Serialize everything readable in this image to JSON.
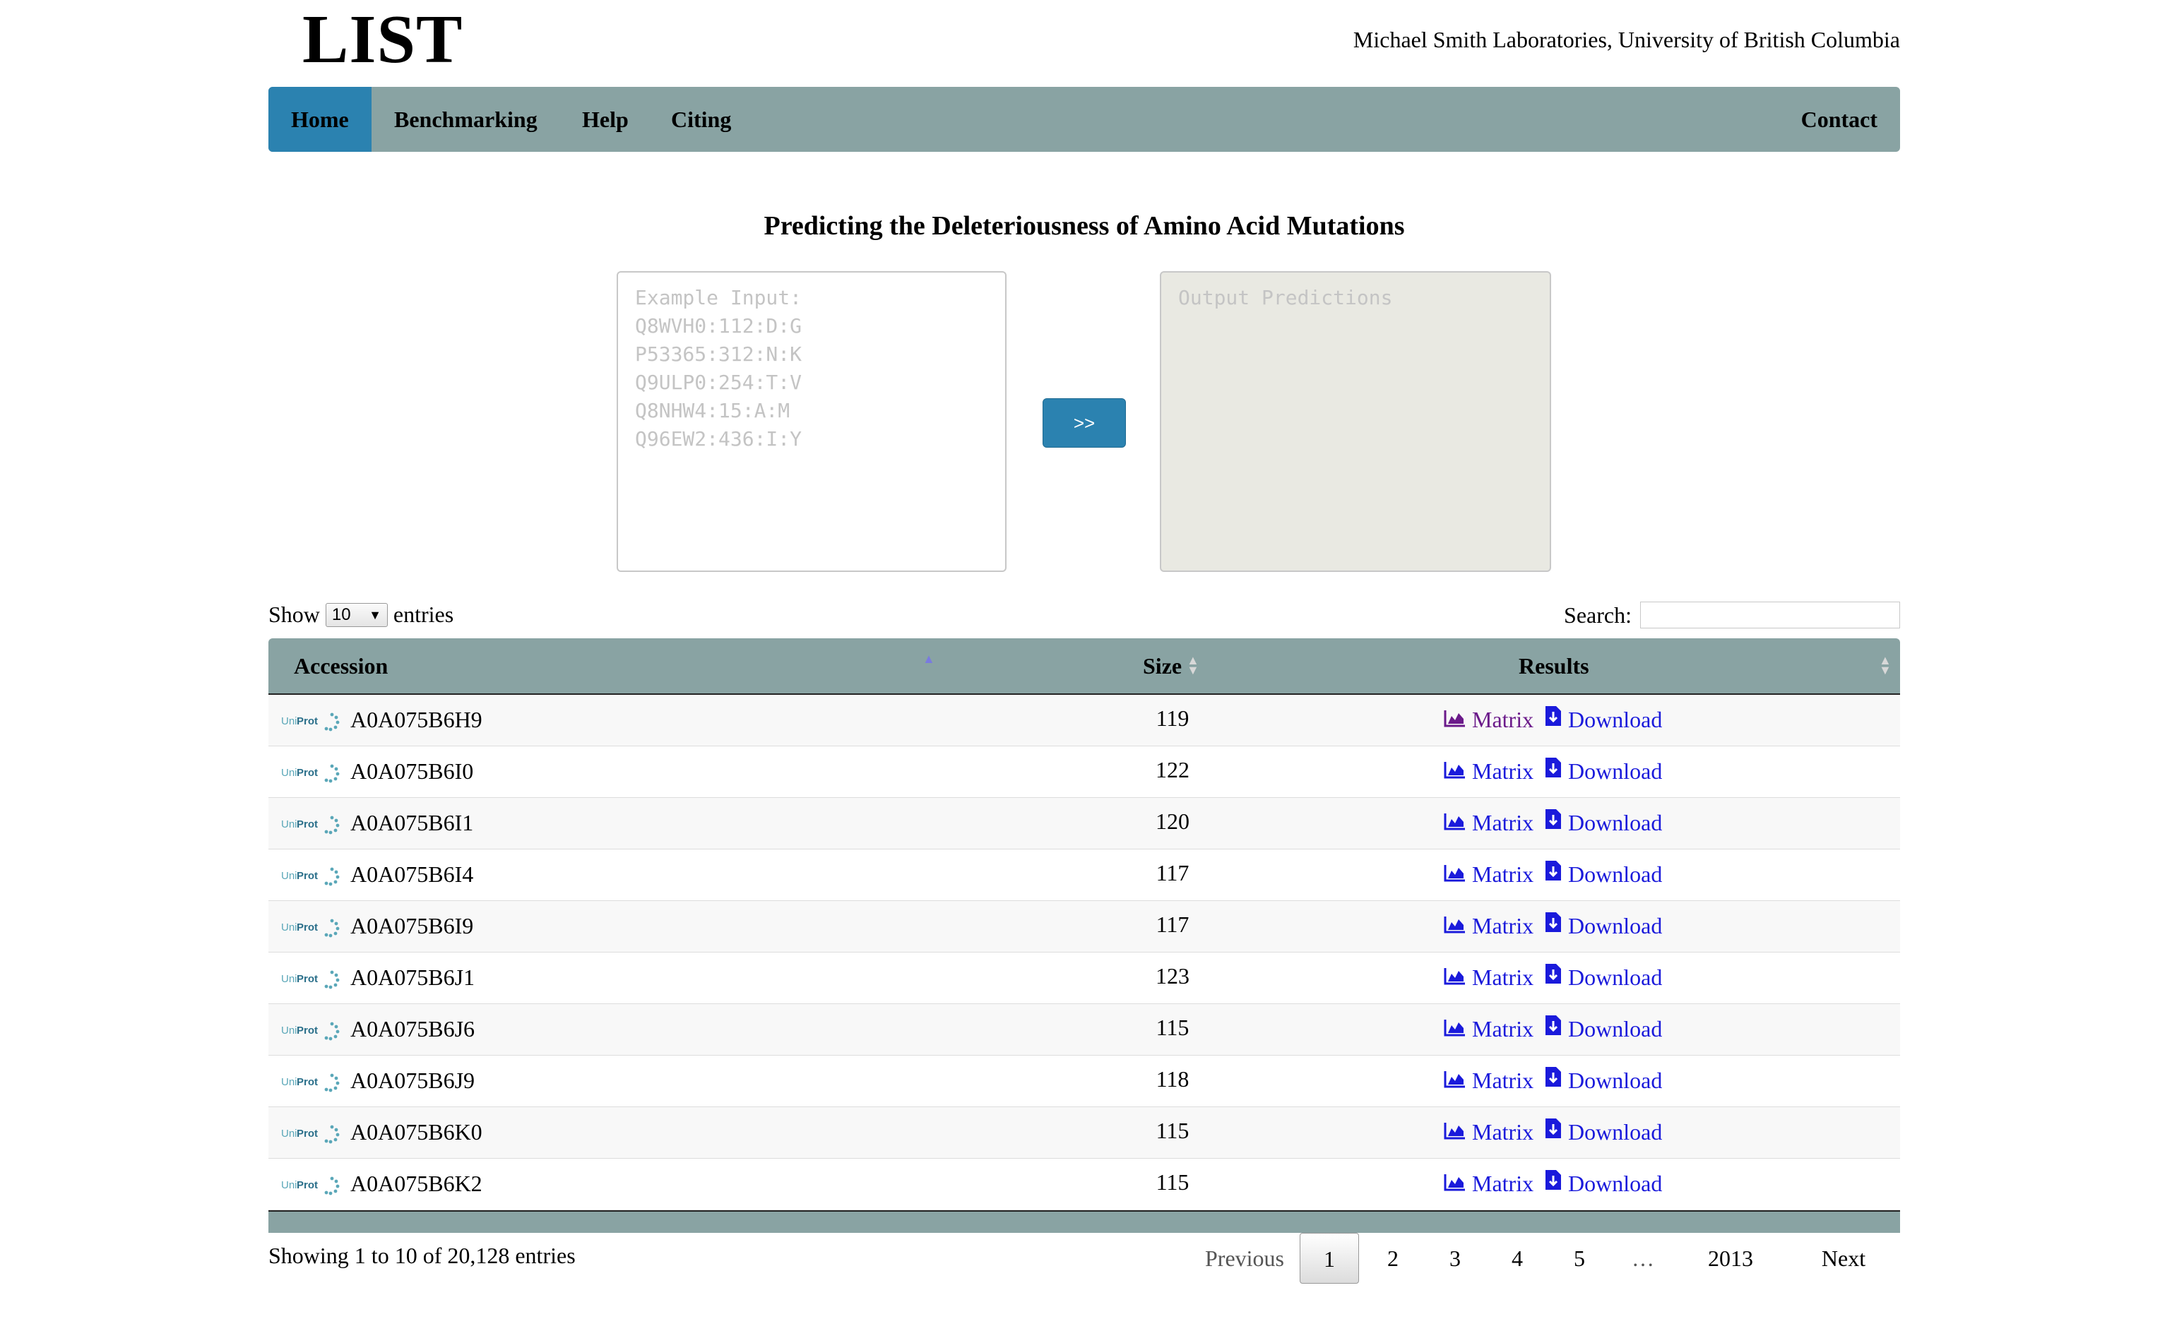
{
  "header": {
    "logo": "LIST",
    "affiliation": "Michael Smith Laboratories, University of British Columbia"
  },
  "nav": {
    "home": "Home",
    "benchmarking": "Benchmarking",
    "help": "Help",
    "citing": "Citing",
    "contact": "Contact"
  },
  "main": {
    "headline": "Predicting the Deleteriousness of Amino Acid Mutations",
    "input_placeholder": "Example Input:\nQ8WVH0:112:D:G\nP53365:312:N:K\nQ9ULP0:254:T:V\nQ8NHW4:15:A:M\nQ96EW2:436:I:Y",
    "submit_label": ">>",
    "output_placeholder": "Output Predictions"
  },
  "table_controls": {
    "show_prefix": "Show",
    "page_size": "10",
    "show_suffix": "entries",
    "search_label": "Search:"
  },
  "table": {
    "columns": [
      "Accession",
      "Size",
      "Results"
    ],
    "link_matrix": "Matrix",
    "link_download": "Download",
    "rows": [
      {
        "accession": "A0A075B6H9",
        "size": "119"
      },
      {
        "accession": "A0A075B6I0",
        "size": "122"
      },
      {
        "accession": "A0A075B6I1",
        "size": "120"
      },
      {
        "accession": "A0A075B6I4",
        "size": "117"
      },
      {
        "accession": "A0A075B6I9",
        "size": "117"
      },
      {
        "accession": "A0A075B6J1",
        "size": "123"
      },
      {
        "accession": "A0A075B6J6",
        "size": "115"
      },
      {
        "accession": "A0A075B6J9",
        "size": "118"
      },
      {
        "accession": "A0A075B6K0",
        "size": "115"
      },
      {
        "accession": "A0A075B6K2",
        "size": "115"
      }
    ]
  },
  "footer": {
    "info": "Showing 1 to 10 of 20,128 entries",
    "pagination": {
      "previous": "Previous",
      "pages": [
        "1",
        "2",
        "3",
        "4",
        "5",
        "…",
        "2013"
      ],
      "next": "Next"
    }
  },
  "colors": {
    "nav_bg": "#89a3a3",
    "accent": "#2b82b0",
    "link": "#1a1adb",
    "visited_link": "#6b1a8a"
  },
  "icons": {
    "chart": "area-chart-icon",
    "download": "file-download-icon",
    "uniprot": "uniprot-logo"
  }
}
